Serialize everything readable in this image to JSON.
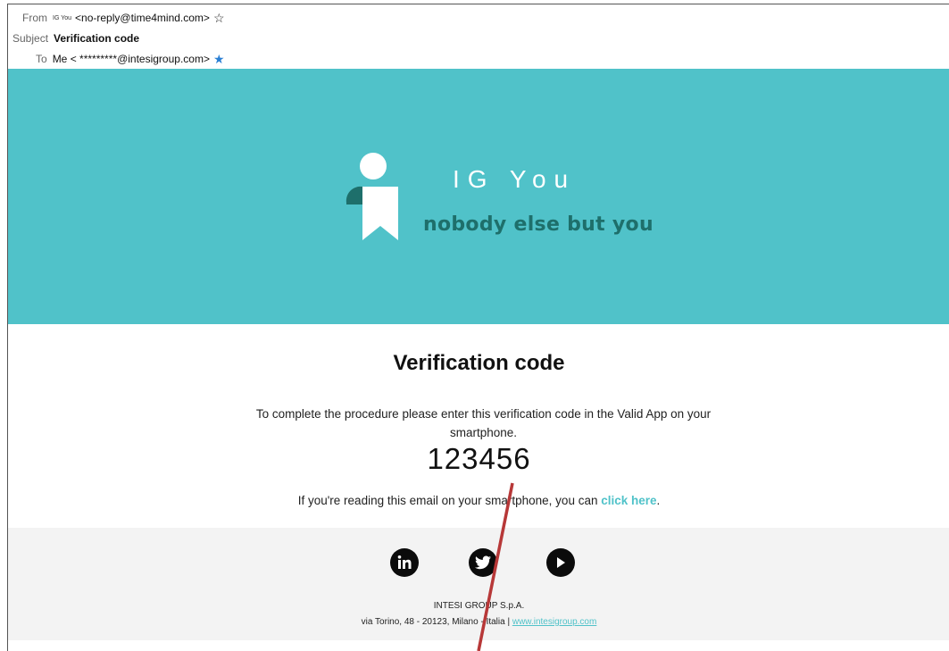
{
  "headers": {
    "from_label": "From",
    "from_sender_name": "IG You",
    "from_address": "<no-reply@time4mind.com>",
    "subject_label": "Subject",
    "subject_value": "Verification code",
    "to_label": "To",
    "to_value": "Me < *********@intesigroup.com>"
  },
  "banner": {
    "brand": "IG You",
    "tagline": "nobody else but you",
    "background": "#50c2c9",
    "tagline_color": "#1e6f6b"
  },
  "body": {
    "title": "Verification code",
    "instructions": "To complete the procedure please enter this verification code in the Valid App on your smartphone.",
    "code": "123456",
    "smartphone_text": "If you're reading this email on your smartphone, you can ",
    "click_here": "click here",
    "after_link": "."
  },
  "footer": {
    "social_icons": [
      "linkedin-icon",
      "twitter-icon",
      "youtube-icon"
    ],
    "company": "INTESI GROUP S.p.A.",
    "address": "via Torino, 48 - 20123, Milano - Italia | ",
    "website": "www.intesigroup.com"
  }
}
